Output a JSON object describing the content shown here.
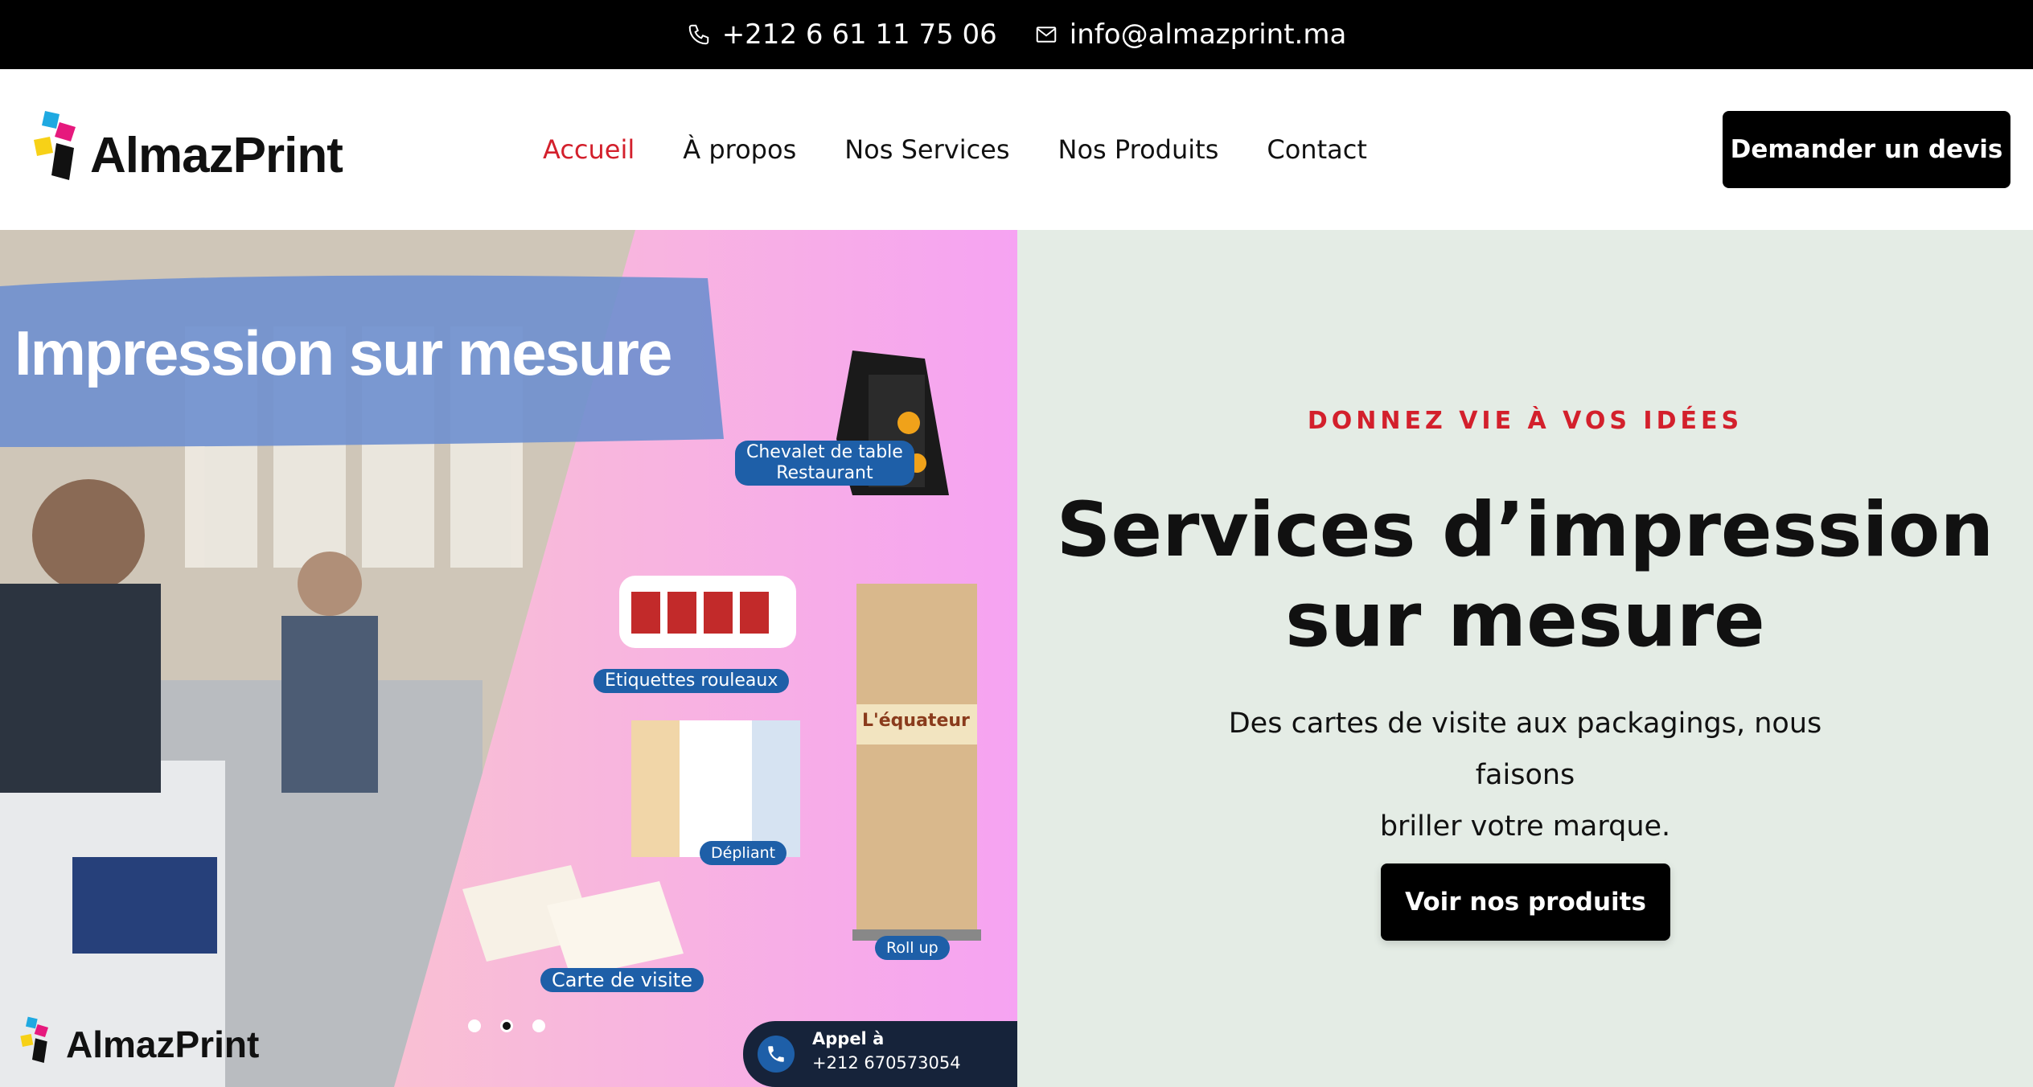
{
  "topbar": {
    "phone": "+212 6 61 11 75 06",
    "email": "info@almazprint.ma",
    "phone_icon": "phone-icon",
    "email_icon": "mail-icon"
  },
  "header": {
    "logo_text": "AlmazPrint",
    "nav": [
      {
        "label": "Accueil",
        "active": true
      },
      {
        "label": "À propos",
        "active": false
      },
      {
        "label": "Nos Services",
        "active": false
      },
      {
        "label": "Nos Produits",
        "active": false
      },
      {
        "label": "Contact",
        "active": false
      }
    ],
    "cta_label": "Demander un devis"
  },
  "hero": {
    "eyebrow": "DONNEZ VIE À VOS IDÉES",
    "title_line1": "Services d’impression",
    "title_line2": "sur mesure",
    "lead_line1": "Des cartes de visite aux packagings, nous faisons",
    "lead_line2": "briller votre marque.",
    "cta_label": "Voir nos produits",
    "accent_color": "#d3202c",
    "panel_color": "#e4ece5"
  },
  "slider": {
    "title": "Impression sur mesure",
    "labels": {
      "chevalet_1": "Chevalet de table",
      "chevalet_2": "Restaurant",
      "etiquettes": "Etiquettes rouleaux",
      "depliant": "Dépliant",
      "rollup": "Roll up",
      "carte": "Carte de visite",
      "rollup_brand": "L'équateur"
    },
    "call_label": "Appel à",
    "call_number": "+212 670573054",
    "logo_text": "AlmazPrint",
    "slide_count": 3,
    "active_slide": 2
  }
}
